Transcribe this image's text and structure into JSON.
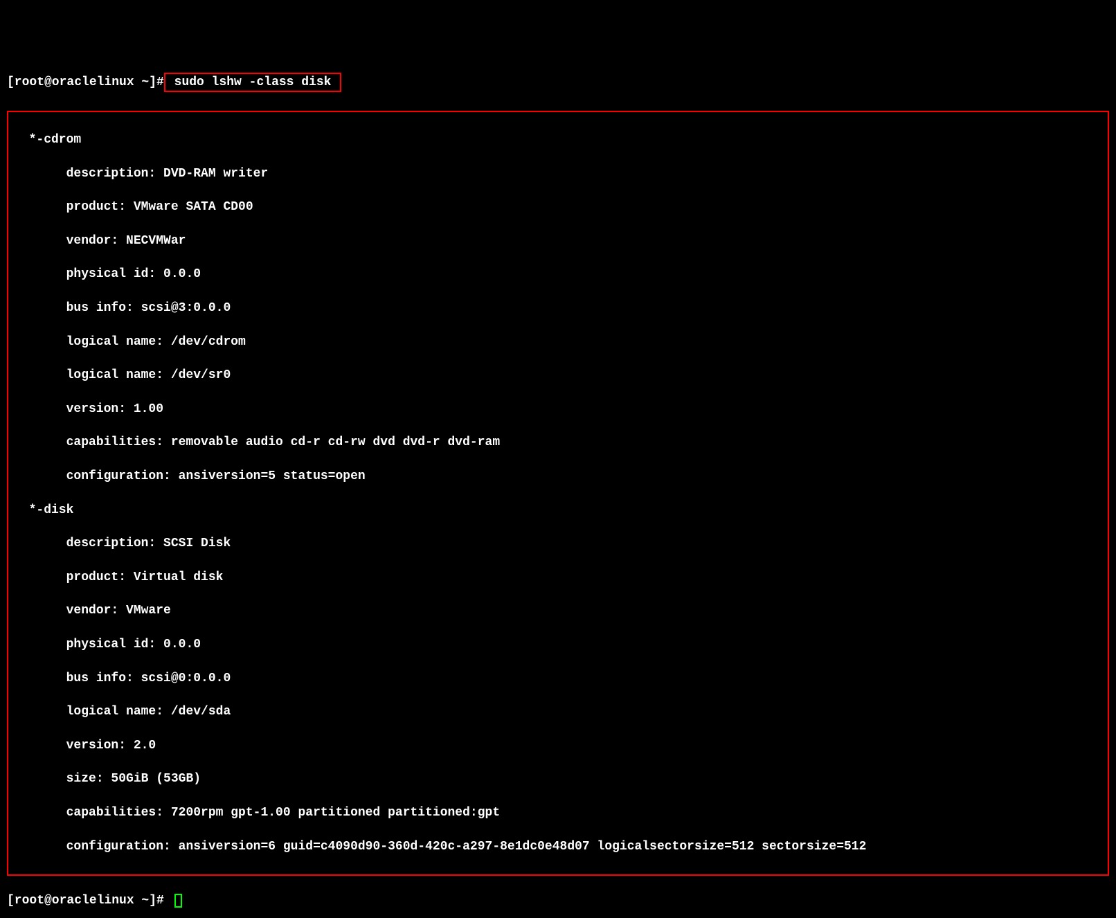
{
  "prompt1": {
    "full": "[root@oraclelinux ~]#",
    "command": " sudo lshw -class disk "
  },
  "output": {
    "cdrom": {
      "header": "  *-cdrom",
      "description": "       description: DVD-RAM writer",
      "product": "       product: VMware SATA CD00",
      "vendor": "       vendor: NECVMWar",
      "physical_id": "       physical id: 0.0.0",
      "bus_info": "       bus info: scsi@3:0.0.0",
      "logical_name1": "       logical name: /dev/cdrom",
      "logical_name2": "       logical name: /dev/sr0",
      "version": "       version: 1.00",
      "capabilities": "       capabilities: removable audio cd-r cd-rw dvd dvd-r dvd-ram",
      "configuration": "       configuration: ansiversion=5 status=open"
    },
    "disk": {
      "header": "  *-disk",
      "description": "       description: SCSI Disk",
      "product": "       product: Virtual disk",
      "vendor": "       vendor: VMware",
      "physical_id": "       physical id: 0.0.0",
      "bus_info": "       bus info: scsi@0:0.0.0",
      "logical_name": "       logical name: /dev/sda",
      "version": "       version: 2.0",
      "size": "       size: 50GiB (53GB)",
      "capabilities": "       capabilities: 7200rpm gpt-1.00 partitioned partitioned:gpt",
      "configuration": "       configuration: ansiversion=6 guid=c4090d90-360d-420c-a297-8e1dc0e48d07 logicalsectorsize=512 sectorsize=512"
    }
  },
  "prompt2": {
    "full": "[root@oraclelinux ~]#"
  }
}
